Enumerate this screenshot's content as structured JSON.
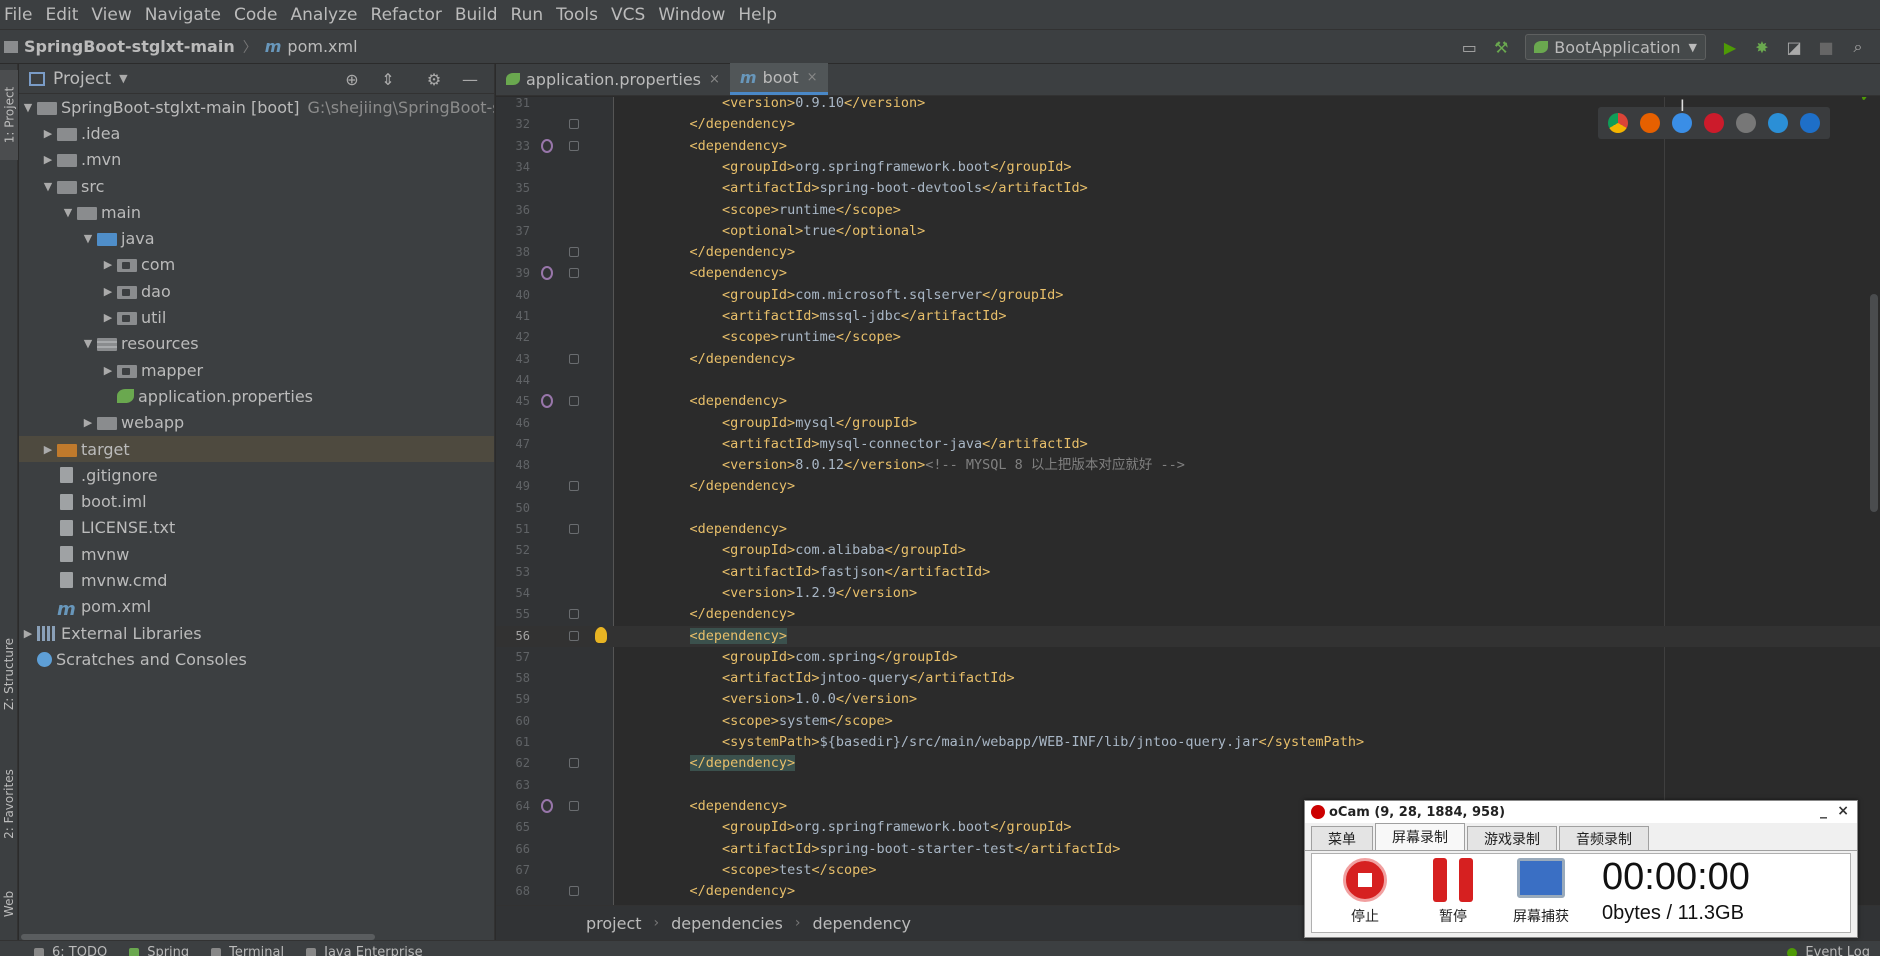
{
  "menu": [
    "File",
    "Edit",
    "View",
    "Navigate",
    "Code",
    "Analyze",
    "Refactor",
    "Build",
    "Run",
    "Tools",
    "VCS",
    "Window",
    "Help"
  ],
  "nav": {
    "project": "SpringBoot-stglxt-main",
    "file_icon": "m",
    "file": "pom.xml",
    "run_config": "BootApplication"
  },
  "side_tabs": {
    "project": "1: Project",
    "structure": "Z: Structure",
    "favorites": "2: Favorites",
    "web": "Web"
  },
  "project_panel": {
    "title": "Project",
    "root": {
      "name": "SpringBoot-stglxt-main [boot]",
      "path": "G:\\shejiing\\SpringBoot-stgl"
    },
    "items": [
      {
        "label": ".idea"
      },
      {
        "label": ".mvn"
      },
      {
        "label": "src"
      },
      {
        "label": "main"
      },
      {
        "label": "java"
      },
      {
        "label": "com"
      },
      {
        "label": "dao"
      },
      {
        "label": "util"
      },
      {
        "label": "resources"
      },
      {
        "label": "mapper"
      },
      {
        "label": "application.properties"
      },
      {
        "label": "webapp"
      },
      {
        "label": "target"
      },
      {
        "label": ".gitignore"
      },
      {
        "label": "boot.iml"
      },
      {
        "label": "LICENSE.txt"
      },
      {
        "label": "mvnw"
      },
      {
        "label": "mvnw.cmd"
      },
      {
        "label": "pom.xml"
      },
      {
        "label": "External Libraries"
      },
      {
        "label": "Scratches and Consoles"
      }
    ]
  },
  "tabs": [
    {
      "label": "application.properties",
      "close": "×"
    },
    {
      "icon": "m",
      "label": "boot",
      "close": "×"
    }
  ],
  "code_lines": [
    {
      "n": "31",
      "indent": "        ",
      "t": "<version>",
      "v": "0.9.10",
      "c": "</version>"
    },
    {
      "n": "32",
      "indent": "    ",
      "t": "</dependency>"
    },
    {
      "n": "33",
      "indent": "    ",
      "t": "<dependency>"
    },
    {
      "n": "34",
      "indent": "        ",
      "t": "<groupId>",
      "v": "org.springframework.boot",
      "c": "</groupId>"
    },
    {
      "n": "35",
      "indent": "        ",
      "t": "<artifactId>",
      "v": "spring-boot-devtools",
      "c": "</artifactId>"
    },
    {
      "n": "36",
      "indent": "        ",
      "t": "<scope>",
      "v": "runtime",
      "c": "</scope>"
    },
    {
      "n": "37",
      "indent": "        ",
      "t": "<optional>",
      "v": "true",
      "c": "</optional>"
    },
    {
      "n": "38",
      "indent": "    ",
      "t": "</dependency>"
    },
    {
      "n": "39",
      "indent": "    ",
      "t": "<dependency>"
    },
    {
      "n": "40",
      "indent": "        ",
      "t": "<groupId>",
      "v": "com.microsoft.sqlserver",
      "c": "</groupId>"
    },
    {
      "n": "41",
      "indent": "        ",
      "t": "<artifactId>",
      "v": "mssql-jdbc",
      "c": "</artifactId>"
    },
    {
      "n": "42",
      "indent": "        ",
      "t": "<scope>",
      "v": "runtime",
      "c": "</scope>"
    },
    {
      "n": "43",
      "indent": "    ",
      "t": "</dependency>"
    },
    {
      "n": "44",
      "indent": "",
      "t": ""
    },
    {
      "n": "45",
      "indent": "    ",
      "t": "<dependency>"
    },
    {
      "n": "46",
      "indent": "        ",
      "t": "<groupId>",
      "v": "mysql",
      "c": "</groupId>"
    },
    {
      "n": "47",
      "indent": "        ",
      "t": "<artifactId>",
      "v": "mysql-connector-java",
      "c": "</artifactId>"
    },
    {
      "n": "48",
      "indent": "        ",
      "t": "<version>",
      "v": "8.0.12",
      "c": "</version>",
      "cm": "<!-- MYSQL 8 以上把版本对应就好 -->"
    },
    {
      "n": "49",
      "indent": "    ",
      "t": "</dependency>"
    },
    {
      "n": "50",
      "indent": "",
      "t": ""
    },
    {
      "n": "51",
      "indent": "    ",
      "t": "<dependency>"
    },
    {
      "n": "52",
      "indent": "        ",
      "t": "<groupId>",
      "v": "com.alibaba",
      "c": "</groupId>"
    },
    {
      "n": "53",
      "indent": "        ",
      "t": "<artifactId>",
      "v": "fastjson",
      "c": "</artifactId>"
    },
    {
      "n": "54",
      "indent": "        ",
      "t": "<version>",
      "v": "1.2.9",
      "c": "</version>"
    },
    {
      "n": "55",
      "indent": "    ",
      "t": "</dependency>"
    },
    {
      "n": "56",
      "indent": "    ",
      "t": "<dependency>"
    },
    {
      "n": "57",
      "indent": "        ",
      "t": "<groupId>",
      "v": "com.spring",
      "c": "</groupId>"
    },
    {
      "n": "58",
      "indent": "        ",
      "t": "<artifactId>",
      "v": "jntoo-query",
      "c": "</artifactId>"
    },
    {
      "n": "59",
      "indent": "        ",
      "t": "<version>",
      "v": "1.0.0",
      "c": "</version>"
    },
    {
      "n": "60",
      "indent": "        ",
      "t": "<scope>",
      "v": "system",
      "c": "</scope>"
    },
    {
      "n": "61",
      "indent": "        ",
      "t": "<systemPath>",
      "v": "${basedir}/src/main/webapp/WEB-INF/lib/jntoo-query.jar",
      "c": "</systemPath>"
    },
    {
      "n": "62",
      "indent": "    ",
      "t": "</dependency>"
    },
    {
      "n": "63",
      "indent": "",
      "t": ""
    },
    {
      "n": "64",
      "indent": "    ",
      "t": "<dependency>"
    },
    {
      "n": "65",
      "indent": "        ",
      "t": "<groupId>",
      "v": "org.springframework.boot",
      "c": "</groupId>"
    },
    {
      "n": "66",
      "indent": "        ",
      "t": "<artifactId>",
      "v": "spring-boot-starter-test",
      "c": "</artifactId>"
    },
    {
      "n": "67",
      "indent": "        ",
      "t": "<scope>",
      "v": "test",
      "c": "</scope>"
    },
    {
      "n": "68",
      "indent": "    ",
      "t": "</dependency>"
    }
  ],
  "editor_breadcrumb": [
    "project",
    "dependencies",
    "dependency"
  ],
  "status_items": [
    "6: TODO",
    "Spring",
    "Terminal",
    "Java Enterprise",
    "Event Log"
  ],
  "ocam": {
    "title": "oCam (9, 28, 1884, 958)",
    "minimize": "_",
    "close": "×",
    "tabs": [
      "菜单",
      "屏幕录制",
      "游戏录制",
      "音频录制"
    ],
    "stop": "停止",
    "pause": "暂停",
    "capture": "屏幕捕获",
    "timer": "00:00:00",
    "size": "0bytes / 11.3GB"
  },
  "icons": {
    "menu_folder": "folder-icon",
    "run": "run-icon",
    "debug": "debug-icon",
    "search": "search-icon"
  }
}
